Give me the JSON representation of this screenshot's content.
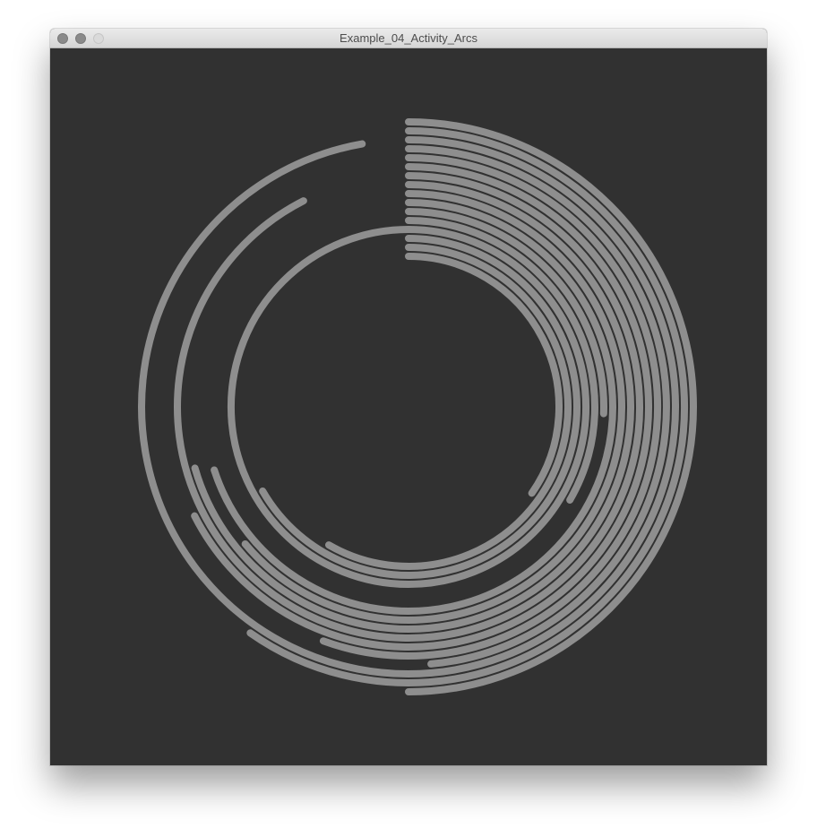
{
  "window": {
    "title": "Example_04_Activity_Arcs"
  },
  "sketch": {
    "background_color": "#313131",
    "stroke_color": "#8e8e8e",
    "arcs": [
      {
        "radius": 318,
        "start_deg": 0,
        "end_deg": 180
      },
      {
        "radius": 308,
        "start_deg": 0,
        "end_deg": 215
      },
      {
        "radius": 298,
        "start_deg": 0,
        "end_deg": 350
      },
      {
        "radius": 288,
        "start_deg": 0,
        "end_deg": 175
      },
      {
        "radius": 278,
        "start_deg": 0,
        "end_deg": 200
      },
      {
        "radius": 268,
        "start_deg": 0,
        "end_deg": 243
      },
      {
        "radius": 258,
        "start_deg": 0,
        "end_deg": 333
      },
      {
        "radius": 248,
        "start_deg": 0,
        "end_deg": 254
      },
      {
        "radius": 238,
        "start_deg": 0,
        "end_deg": 230
      },
      {
        "radius": 228,
        "start_deg": 0,
        "end_deg": 252
      },
      {
        "radius": 218,
        "start_deg": 0,
        "end_deg": 92
      },
      {
        "radius": 208,
        "start_deg": 0,
        "end_deg": 120
      },
      {
        "radius": 198,
        "start_deg": 0,
        "end_deg": 360
      },
      {
        "radius": 188,
        "start_deg": 0,
        "end_deg": 240
      },
      {
        "radius": 178,
        "start_deg": 0,
        "end_deg": 210
      },
      {
        "radius": 168,
        "start_deg": 0,
        "end_deg": 125
      }
    ]
  }
}
